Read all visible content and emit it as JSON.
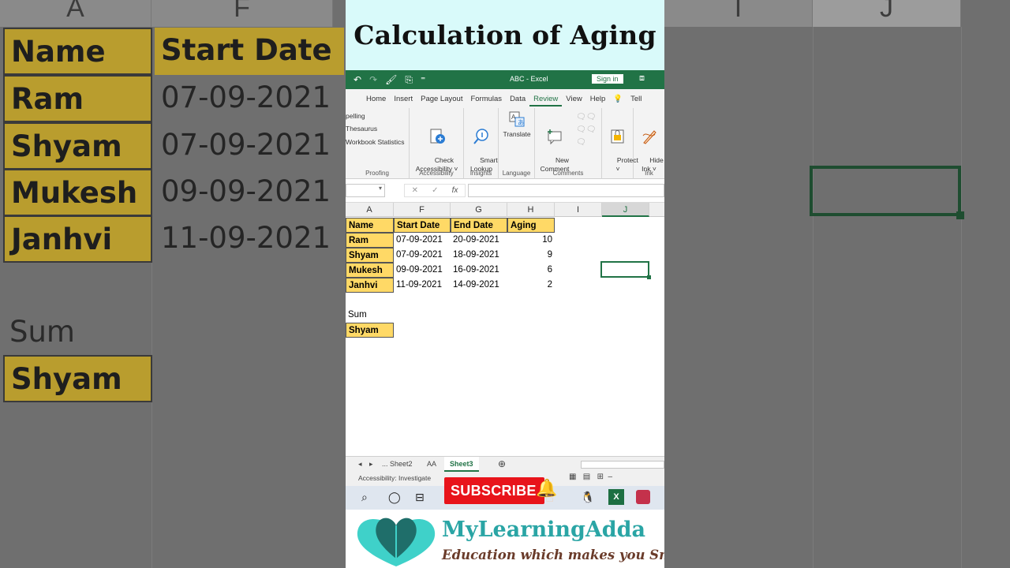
{
  "video_title": "Calculation of Aging",
  "excel": {
    "doc_title": "ABC  -  Excel",
    "sign_in": "Sign in",
    "tabs": [
      "Home",
      "Insert",
      "Page Layout",
      "Formulas",
      "Data",
      "Review",
      "View",
      "Help",
      "Tell"
    ],
    "active_tab": "Review",
    "ribbon": {
      "proofing_items": [
        "pelling",
        "Thesaurus",
        "Workbook Statistics"
      ],
      "proofing_label": "Proofing",
      "check_accessibility": "Check\nAccessibility ˅",
      "accessibility_label": "Accessibility",
      "smart_lookup": "Smart\nLookup",
      "insights_label": "Insights",
      "translate": "Translate",
      "language_label": "Language",
      "new_comment": "New\nComment",
      "comments_label": "Comments",
      "protect": "Protect\n˅",
      "hide_ink": "Hide\nInk ˅",
      "ink_label": "Ink"
    },
    "formula_bar": {
      "fx": "fx",
      "cancel": "✕",
      "enter": "✓"
    },
    "columns": [
      "A",
      "F",
      "G",
      "H",
      "I",
      "J"
    ],
    "table": {
      "headers": [
        "Name",
        "Start Date",
        "End Date",
        "Aging"
      ],
      "rows": [
        [
          "Ram",
          "07-09-2021",
          "20-09-2021",
          "10"
        ],
        [
          "Shyam",
          "07-09-2021",
          "18-09-2021",
          "9"
        ],
        [
          "Mukesh",
          "09-09-2021",
          "16-09-2021",
          "6"
        ],
        [
          "Janhvi",
          "11-09-2021",
          "14-09-2021",
          "2"
        ]
      ]
    },
    "sum_label": "Sum",
    "sum_name": "Shyam",
    "sheet_tabs": [
      "...",
      "Sheet2",
      "AA",
      "Sheet3"
    ],
    "active_sheet": "Sheet3",
    "status": "Accessibility: Investigate"
  },
  "subscribe": "SUBSCRIBE",
  "brand": {
    "name": "MyLearningAdda",
    "tagline": "Education which makes you Smile"
  },
  "background": {
    "col_labels": [
      "A",
      "F",
      "I",
      "J"
    ],
    "rows": [
      [
        "Name",
        "Start Date"
      ],
      [
        "Ram",
        "07-09-2021"
      ],
      [
        "Shyam",
        "07-09-2021"
      ],
      [
        "Mukesh",
        "09-09-2021"
      ],
      [
        "Janhvi",
        "11-09-2021"
      ]
    ],
    "sum_label": "Sum",
    "sum_name": "Shyam"
  },
  "colors": {
    "excel_green": "#217346",
    "header_yellow": "#ffd966",
    "title_bg": "#d9fafa",
    "subscribe_red": "#e8141b",
    "brand_teal": "#2aa5a5"
  }
}
